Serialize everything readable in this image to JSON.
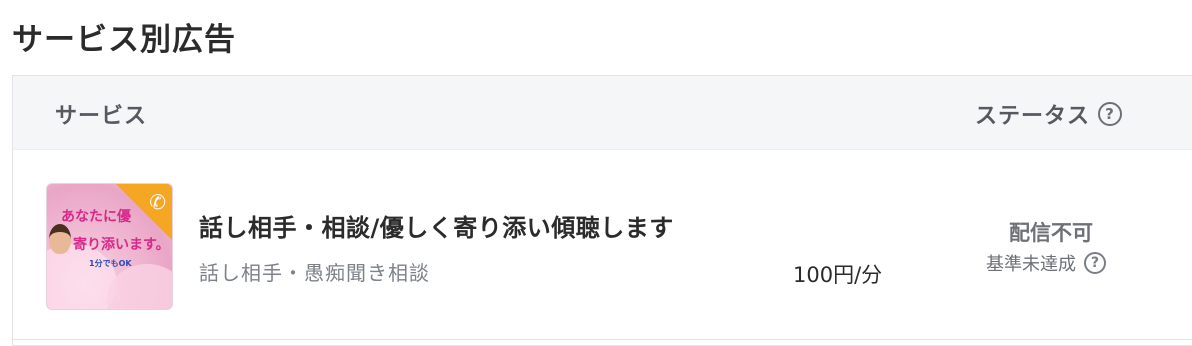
{
  "page": {
    "title": "サービス別広告"
  },
  "table": {
    "headers": {
      "service": "サービス",
      "status": "ステータス",
      "next": "・"
    },
    "rows": [
      {
        "thumbnail": {
          "line1": "あなたに優",
          "line2": "寄り添います。",
          "line3": "1分でもOK",
          "icon": "phone-icon"
        },
        "title": "話し相手・相談/優しく寄り添い傾聴します",
        "category": "話し相手・愚痴聞き相談",
        "price": "100円/分",
        "status": "配信不可",
        "status_reason": "基準未達成"
      }
    ]
  },
  "icons": {
    "help": "?"
  },
  "colors": {
    "accent_orange": "#f5a623",
    "header_bg": "#f5f6f8"
  }
}
